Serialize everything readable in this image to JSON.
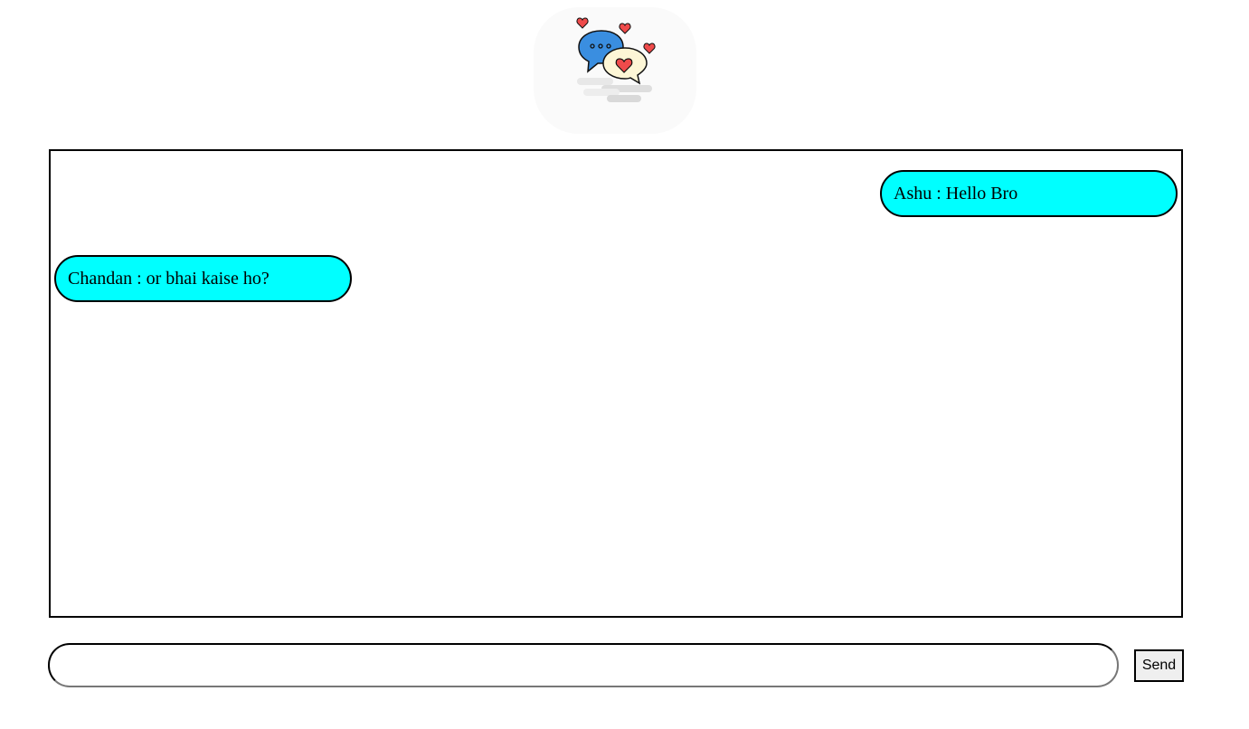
{
  "messages": [
    {
      "side": "right",
      "text": "Ashu : Hello Bro"
    },
    {
      "side": "left",
      "text": "Chandan : or bhai kaise ho?"
    }
  ],
  "composer": {
    "value": "",
    "placeholder": "",
    "send_label": "Send"
  },
  "colors": {
    "bubble": "#00ffff",
    "border": "#000000",
    "logo_blue": "#3a8ee0",
    "logo_cream": "#fdf6d6",
    "heart": "#ef4b4b"
  },
  "icons": {
    "logo": "chat-hearts-logo"
  }
}
